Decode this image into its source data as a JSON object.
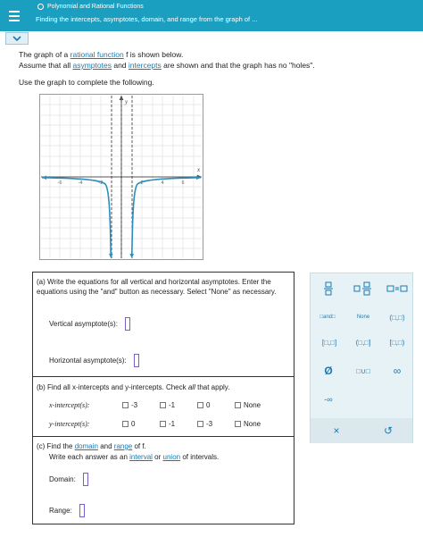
{
  "header": {
    "breadcrumb": "Polynomial and Rational Functions",
    "title": "Finding the intercepts, asymptotes, domain, and range from the graph of ..."
  },
  "intro": {
    "line1_pre": "The graph of a",
    "line1_link": "rational function",
    "line1_post": "f is shown below.",
    "line2_pre": "Assume that all",
    "line2_link1": "asymptotes",
    "line2_mid": "and",
    "line2_link2": "intercepts",
    "line2_post": "are shown and that the graph has no \"holes\".",
    "line3": "Use the graph to complete the following."
  },
  "graph": {
    "x_label": "x",
    "y_label": "y",
    "x_ticks": [
      "-6",
      "-4",
      "-2",
      "2",
      "4",
      "6"
    ]
  },
  "part_a": {
    "text": "(a) Write the equations for all vertical and horizontal asymptotes. Enter the equations using the \"and\" button as necessary. Select \"None\" as necessary.",
    "vertical_label": "Vertical asymptote(s):",
    "horizontal_label": "Horizontal asymptote(s):"
  },
  "part_b": {
    "text_pre": "(b) Find all x-intercepts and y-intercepts. Check",
    "text_all": "all",
    "text_post": "that apply.",
    "x_label": "x-intercept(s):",
    "x_options": [
      "-3",
      "-1",
      "0",
      "None"
    ],
    "y_label": "y-intercept(s):",
    "y_options": [
      "0",
      "-1",
      "-3",
      "None"
    ]
  },
  "part_c": {
    "line1_pre": "(c) Find the",
    "link_domain": "domain",
    "line1_mid": "and",
    "link_range": "range",
    "line1_post": "of f.",
    "line2_pre": "Write each answer as an",
    "link_interval": "interval",
    "line2_mid": "or",
    "link_union": "union",
    "line2_post": "of intervals.",
    "domain_label": "Domain:",
    "range_label": "Range:"
  },
  "palette": {
    "and": "and",
    "none": "None",
    "open_open": "(□,□)",
    "closed_closed": "[□,□]",
    "open_closed": "(□,□]",
    "closed_open": "[□,□)",
    "empty_set": "Ø",
    "union": "□∪□",
    "infinity": "∞",
    "neg_infinity": "-∞",
    "clear": "×",
    "undo": "↺"
  }
}
